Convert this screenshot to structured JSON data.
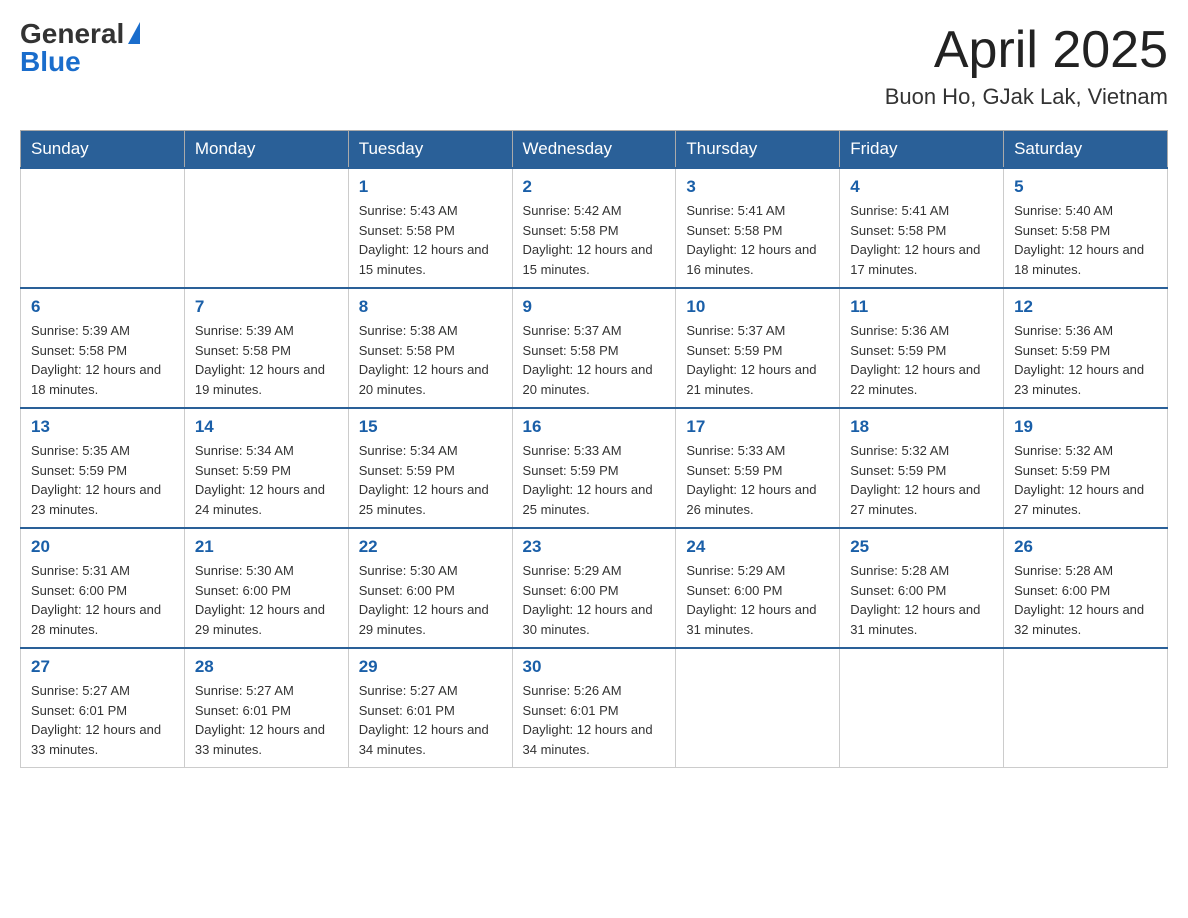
{
  "header": {
    "logo_general": "General",
    "logo_blue": "Blue",
    "month_title": "April 2025",
    "location": "Buon Ho, GJak Lak, Vietnam"
  },
  "days_of_week": [
    "Sunday",
    "Monday",
    "Tuesday",
    "Wednesday",
    "Thursday",
    "Friday",
    "Saturday"
  ],
  "weeks": [
    [
      null,
      null,
      {
        "day": "1",
        "sunrise": "Sunrise: 5:43 AM",
        "sunset": "Sunset: 5:58 PM",
        "daylight": "Daylight: 12 hours and 15 minutes."
      },
      {
        "day": "2",
        "sunrise": "Sunrise: 5:42 AM",
        "sunset": "Sunset: 5:58 PM",
        "daylight": "Daylight: 12 hours and 15 minutes."
      },
      {
        "day": "3",
        "sunrise": "Sunrise: 5:41 AM",
        "sunset": "Sunset: 5:58 PM",
        "daylight": "Daylight: 12 hours and 16 minutes."
      },
      {
        "day": "4",
        "sunrise": "Sunrise: 5:41 AM",
        "sunset": "Sunset: 5:58 PM",
        "daylight": "Daylight: 12 hours and 17 minutes."
      },
      {
        "day": "5",
        "sunrise": "Sunrise: 5:40 AM",
        "sunset": "Sunset: 5:58 PM",
        "daylight": "Daylight: 12 hours and 18 minutes."
      }
    ],
    [
      {
        "day": "6",
        "sunrise": "Sunrise: 5:39 AM",
        "sunset": "Sunset: 5:58 PM",
        "daylight": "Daylight: 12 hours and 18 minutes."
      },
      {
        "day": "7",
        "sunrise": "Sunrise: 5:39 AM",
        "sunset": "Sunset: 5:58 PM",
        "daylight": "Daylight: 12 hours and 19 minutes."
      },
      {
        "day": "8",
        "sunrise": "Sunrise: 5:38 AM",
        "sunset": "Sunset: 5:58 PM",
        "daylight": "Daylight: 12 hours and 20 minutes."
      },
      {
        "day": "9",
        "sunrise": "Sunrise: 5:37 AM",
        "sunset": "Sunset: 5:58 PM",
        "daylight": "Daylight: 12 hours and 20 minutes."
      },
      {
        "day": "10",
        "sunrise": "Sunrise: 5:37 AM",
        "sunset": "Sunset: 5:59 PM",
        "daylight": "Daylight: 12 hours and 21 minutes."
      },
      {
        "day": "11",
        "sunrise": "Sunrise: 5:36 AM",
        "sunset": "Sunset: 5:59 PM",
        "daylight": "Daylight: 12 hours and 22 minutes."
      },
      {
        "day": "12",
        "sunrise": "Sunrise: 5:36 AM",
        "sunset": "Sunset: 5:59 PM",
        "daylight": "Daylight: 12 hours and 23 minutes."
      }
    ],
    [
      {
        "day": "13",
        "sunrise": "Sunrise: 5:35 AM",
        "sunset": "Sunset: 5:59 PM",
        "daylight": "Daylight: 12 hours and 23 minutes."
      },
      {
        "day": "14",
        "sunrise": "Sunrise: 5:34 AM",
        "sunset": "Sunset: 5:59 PM",
        "daylight": "Daylight: 12 hours and 24 minutes."
      },
      {
        "day": "15",
        "sunrise": "Sunrise: 5:34 AM",
        "sunset": "Sunset: 5:59 PM",
        "daylight": "Daylight: 12 hours and 25 minutes."
      },
      {
        "day": "16",
        "sunrise": "Sunrise: 5:33 AM",
        "sunset": "Sunset: 5:59 PM",
        "daylight": "Daylight: 12 hours and 25 minutes."
      },
      {
        "day": "17",
        "sunrise": "Sunrise: 5:33 AM",
        "sunset": "Sunset: 5:59 PM",
        "daylight": "Daylight: 12 hours and 26 minutes."
      },
      {
        "day": "18",
        "sunrise": "Sunrise: 5:32 AM",
        "sunset": "Sunset: 5:59 PM",
        "daylight": "Daylight: 12 hours and 27 minutes."
      },
      {
        "day": "19",
        "sunrise": "Sunrise: 5:32 AM",
        "sunset": "Sunset: 5:59 PM",
        "daylight": "Daylight: 12 hours and 27 minutes."
      }
    ],
    [
      {
        "day": "20",
        "sunrise": "Sunrise: 5:31 AM",
        "sunset": "Sunset: 6:00 PM",
        "daylight": "Daylight: 12 hours and 28 minutes."
      },
      {
        "day": "21",
        "sunrise": "Sunrise: 5:30 AM",
        "sunset": "Sunset: 6:00 PM",
        "daylight": "Daylight: 12 hours and 29 minutes."
      },
      {
        "day": "22",
        "sunrise": "Sunrise: 5:30 AM",
        "sunset": "Sunset: 6:00 PM",
        "daylight": "Daylight: 12 hours and 29 minutes."
      },
      {
        "day": "23",
        "sunrise": "Sunrise: 5:29 AM",
        "sunset": "Sunset: 6:00 PM",
        "daylight": "Daylight: 12 hours and 30 minutes."
      },
      {
        "day": "24",
        "sunrise": "Sunrise: 5:29 AM",
        "sunset": "Sunset: 6:00 PM",
        "daylight": "Daylight: 12 hours and 31 minutes."
      },
      {
        "day": "25",
        "sunrise": "Sunrise: 5:28 AM",
        "sunset": "Sunset: 6:00 PM",
        "daylight": "Daylight: 12 hours and 31 minutes."
      },
      {
        "day": "26",
        "sunrise": "Sunrise: 5:28 AM",
        "sunset": "Sunset: 6:00 PM",
        "daylight": "Daylight: 12 hours and 32 minutes."
      }
    ],
    [
      {
        "day": "27",
        "sunrise": "Sunrise: 5:27 AM",
        "sunset": "Sunset: 6:01 PM",
        "daylight": "Daylight: 12 hours and 33 minutes."
      },
      {
        "day": "28",
        "sunrise": "Sunrise: 5:27 AM",
        "sunset": "Sunset: 6:01 PM",
        "daylight": "Daylight: 12 hours and 33 minutes."
      },
      {
        "day": "29",
        "sunrise": "Sunrise: 5:27 AM",
        "sunset": "Sunset: 6:01 PM",
        "daylight": "Daylight: 12 hours and 34 minutes."
      },
      {
        "day": "30",
        "sunrise": "Sunrise: 5:26 AM",
        "sunset": "Sunset: 6:01 PM",
        "daylight": "Daylight: 12 hours and 34 minutes."
      },
      null,
      null,
      null
    ]
  ]
}
